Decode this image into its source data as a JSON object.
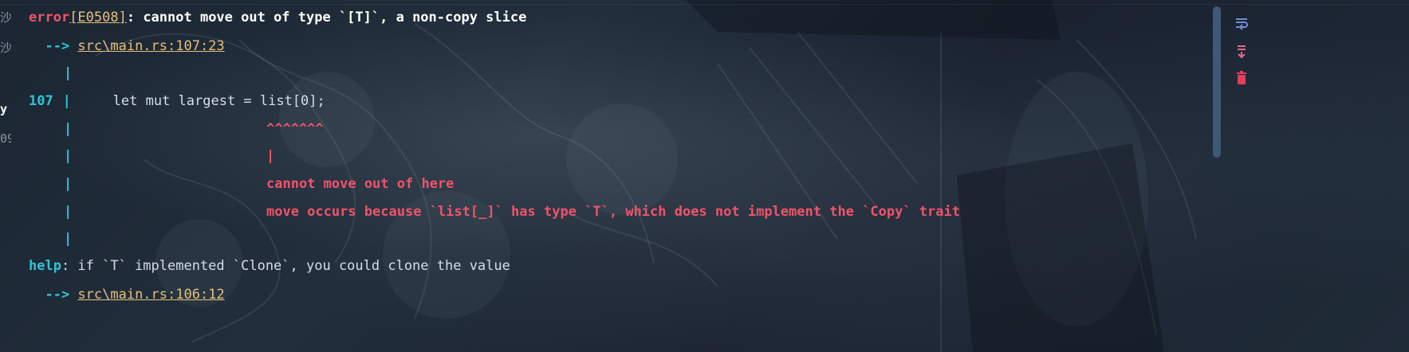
{
  "gutter": {
    "items": [
      "沙",
      "沙",
      "y",
      "09"
    ]
  },
  "console": {
    "error_line": {
      "prefix": "error",
      "code": "[E0508]",
      "message": ": cannot move out of type `[T]`, a non-copy slice"
    },
    "location1": {
      "arrow": "  --> ",
      "path": "src\\main.rs:107:23"
    },
    "pipe": "|",
    "code_line": {
      "line_number": "107",
      "code": "    let mut largest = list[0];"
    },
    "carets": "^^^^^^^",
    "caret_pipe": "|",
    "label1": "cannot move out of here",
    "label2": "move occurs because `list[_]` has type `T`, which does not implement the `Copy` trait",
    "help_line": {
      "prefix": "help",
      "message": ": if `T` implemented `Clone`, you could clone the value"
    },
    "location2": {
      "arrow": "  --> ",
      "path": "src\\main.rs:106:12"
    }
  },
  "toolbar": {
    "icons": [
      "soft-wrap-icon",
      "scroll-to-end-icon",
      "clear-all-icon"
    ]
  },
  "colors": {
    "error_red": "#f0536a",
    "link_yellow": "#e5c07b",
    "cyan": "#2ec4d6",
    "scrollbar": "#3f5875"
  }
}
